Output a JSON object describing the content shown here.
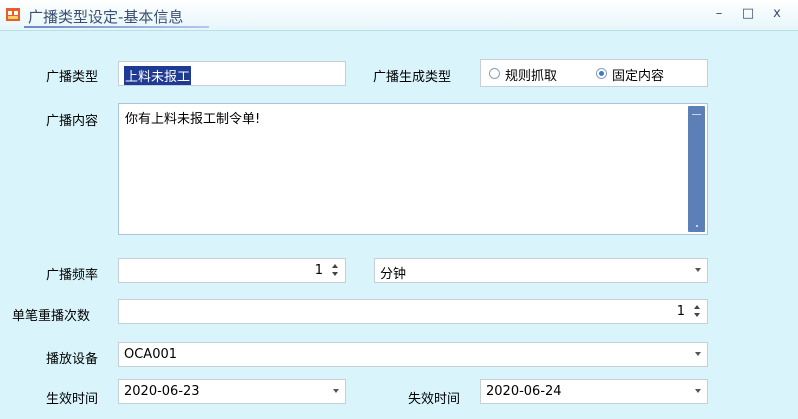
{
  "window": {
    "title": "广播类型设定-基本信息",
    "controls": {
      "minimize": "–",
      "maximize": "□",
      "close": "x"
    }
  },
  "form": {
    "broadcast_type": {
      "label": "广播类型",
      "value": "上料未报工"
    },
    "gen_type": {
      "label": "广播生成类型",
      "options": [
        {
          "label": "规则抓取",
          "selected": false
        },
        {
          "label": "固定内容",
          "selected": true
        }
      ]
    },
    "content": {
      "label": "广播内容",
      "value": "你有上料未报工制令单!"
    },
    "frequency": {
      "label": "广播频率",
      "value": "1",
      "unit": "分钟"
    },
    "repeat_count": {
      "label": "单笔重播次数",
      "value": "1"
    },
    "device": {
      "label": "播放设备",
      "value": "OCA001"
    },
    "effective": {
      "label": "生效时间",
      "value": "2020-06-23"
    },
    "expire": {
      "label": "失效时间",
      "value": "2020-06-24"
    }
  },
  "icons": {
    "app": "app-window-icon",
    "dropdown": "chevron-down-icon",
    "spinner": "spinner-icon"
  },
  "colors": {
    "window_bg": "#d9f5fb",
    "title_text": "#3a5070",
    "selection": "#1f3a93",
    "radio_selected": "#3c78d8",
    "scrollbar": "#5b7fb6"
  }
}
